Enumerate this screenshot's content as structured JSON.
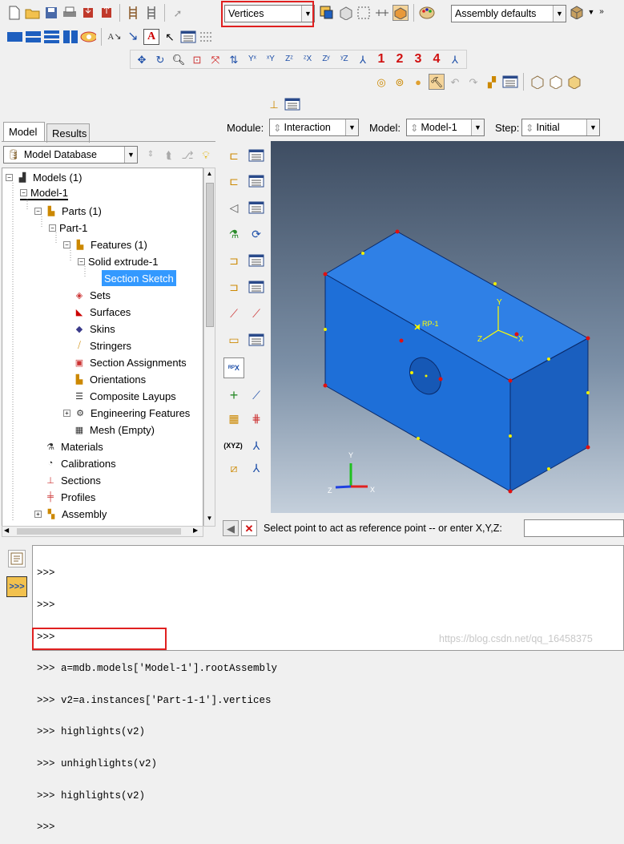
{
  "toolbar": {
    "selection_filter": "Vertices",
    "assembly_display": "Assembly defaults",
    "numbers": [
      "1",
      "2",
      "3",
      "4"
    ]
  },
  "context": {
    "module_label": "Module:",
    "module_value": "Interaction",
    "model_label": "Model:",
    "model_value": "Model-1",
    "step_label": "Step:",
    "step_value": "Initial"
  },
  "tabs": [
    "Model",
    "Results"
  ],
  "tree_filter": "Model Database",
  "tree": [
    {
      "label": "Models (1)",
      "icon": "models-icon"
    },
    {
      "label": "Model-1",
      "icon": ""
    },
    {
      "label": "Parts (1)",
      "icon": "parts-icon"
    },
    {
      "label": "Part-1",
      "icon": ""
    },
    {
      "label": "Features (1)",
      "icon": "features-icon"
    },
    {
      "label": "Solid extrude-1",
      "icon": "feature-icon"
    },
    {
      "label": "Section Sketch",
      "icon": ""
    },
    {
      "label": "Sets",
      "icon": "sets-icon"
    },
    {
      "label": "Surfaces",
      "icon": "surfaces-icon"
    },
    {
      "label": "Skins",
      "icon": "skins-icon"
    },
    {
      "label": "Stringers",
      "icon": "stringers-icon"
    },
    {
      "label": "Section Assignments",
      "icon": "section-assign-icon"
    },
    {
      "label": "Orientations",
      "icon": "orientations-icon"
    },
    {
      "label": "Composite Layups",
      "icon": "layups-icon"
    },
    {
      "label": "Engineering Features",
      "icon": "eng-features-icon"
    },
    {
      "label": "Mesh (Empty)",
      "icon": "mesh-icon"
    },
    {
      "label": "Materials",
      "icon": "materials-icon"
    },
    {
      "label": "Calibrations",
      "icon": "calibrations-icon"
    },
    {
      "label": "Sections",
      "icon": "sections-icon"
    },
    {
      "label": "Profiles",
      "icon": "profiles-icon"
    },
    {
      "label": "Assembly",
      "icon": "assembly-icon"
    }
  ],
  "viewport": {
    "rp_label": "RP-1",
    "triad_local": {
      "x": "X",
      "y": "Y",
      "z": "Z"
    },
    "triad_global": {
      "x": "X",
      "y": "Y",
      "z": "Z"
    },
    "colors": {
      "part": "#1e6fd8",
      "part_top": "#2f80e6",
      "part_side": "#1a5fbf",
      "vertex": "#e01010",
      "midpoint": "#f0f000"
    }
  },
  "prompt": {
    "text": "Select point to act as reference point -- or enter X,Y,Z:",
    "value": ""
  },
  "console": {
    "lines": [
      ">>>",
      ">>>",
      ">>>",
      ">>> a=mdb.models['Model-1'].rootAssembly",
      ">>> v2=a.instances['Part-1-1'].vertices",
      ">>> highlights(v2)",
      ">>> unhighlights(v2)",
      ">>> highlights(v2)",
      ">>>"
    ],
    "watermark": "https://blog.csdn.net/qq_16458375"
  }
}
